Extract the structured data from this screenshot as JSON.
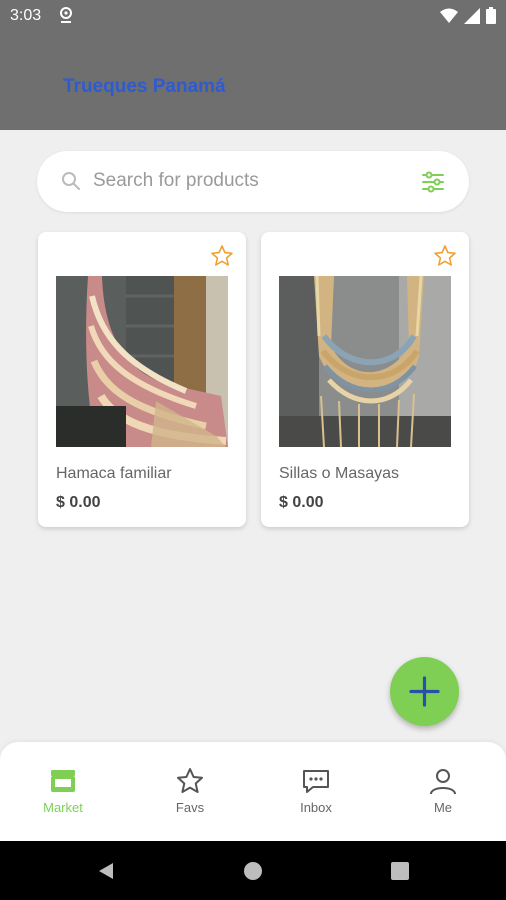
{
  "status_bar": {
    "time": "3:03"
  },
  "app_bar": {
    "title": "Trueques Panamá"
  },
  "search": {
    "placeholder": "Search for products"
  },
  "products": [
    {
      "name": "Hamaca familiar",
      "price": "$ 0.00"
    },
    {
      "name": "Sillas o Masayas",
      "price": "$ 0.00"
    }
  ],
  "bottom_nav": [
    {
      "label": "Market",
      "icon": "store-icon",
      "active": true
    },
    {
      "label": "Favs",
      "icon": "star-icon",
      "active": false
    },
    {
      "label": "Inbox",
      "icon": "chat-icon",
      "active": false
    },
    {
      "label": "Me",
      "icon": "person-icon",
      "active": false
    }
  ],
  "colors": {
    "accent": "#7fcf55",
    "title": "#2f5bd0",
    "star": "#f0a030",
    "app_bar": "#6f6f6f"
  }
}
